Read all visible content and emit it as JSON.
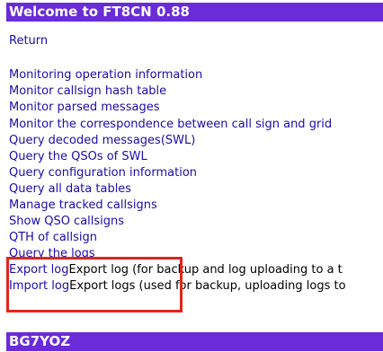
{
  "header": {
    "title": "Welcome to FT8CN 0.88"
  },
  "nav": {
    "return_label": "Return"
  },
  "menu": [
    "Monitoring operation information",
    "Monitor callsign hash table",
    "Monitor parsed messages",
    "Monitor the correspondence between call sign and grid",
    "Query decoded messages(SWL)",
    "Query the QSOs of SWL",
    "Query configuration information",
    "Query all data tables",
    "Manage tracked callsigns",
    "Show QSO callsigns",
    "QTH of callsign",
    "Query the logs"
  ],
  "log_actions": [
    {
      "label": "Export log",
      "desc": "Export log (for backup and log uploading to a t"
    },
    {
      "label": "Import log",
      "desc": "Export logs (used for backup, uploading logs to"
    }
  ],
  "footer": {
    "callsign": "BG7YOZ"
  },
  "colors": {
    "banner": "#6a2bd8",
    "link": "#1a0dab",
    "highlight": "#e1261c"
  }
}
